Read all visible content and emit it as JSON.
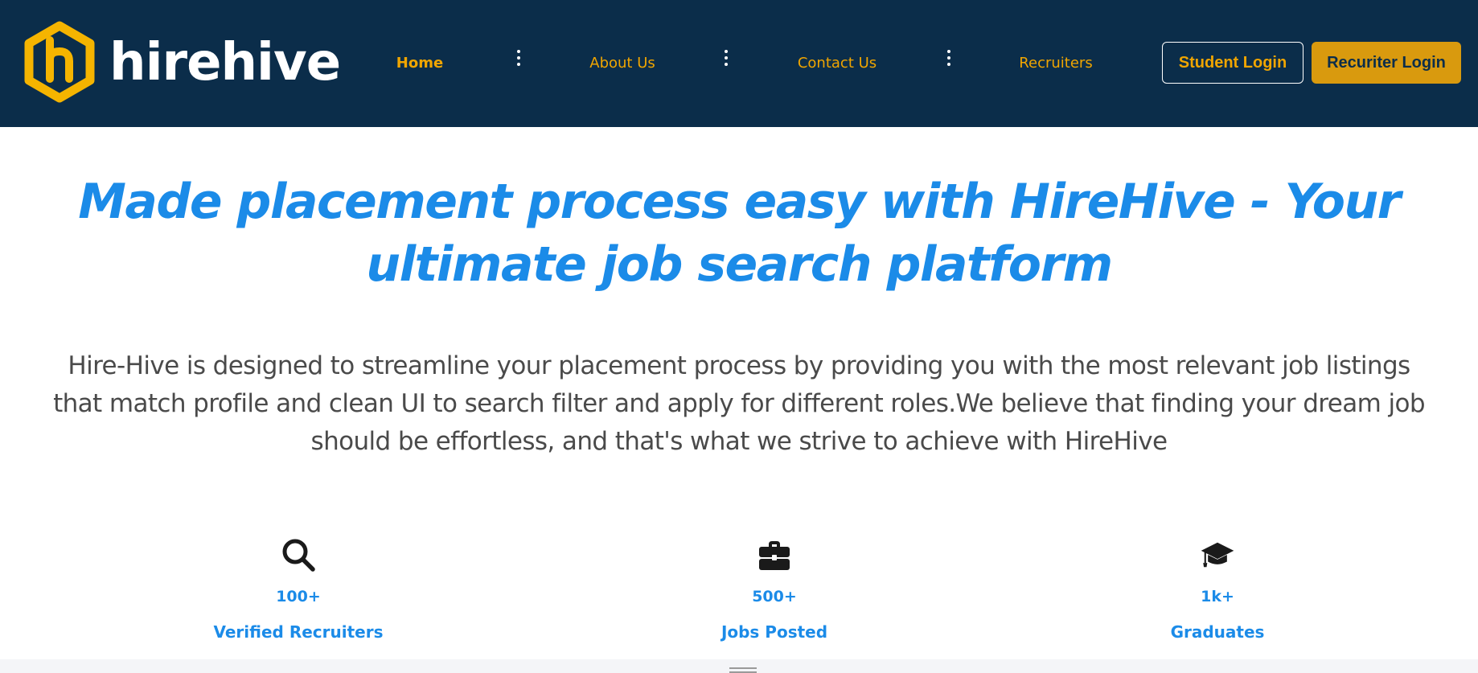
{
  "brand": {
    "name": "hirehive",
    "logo_icon": "hexagon-h-logo-icon",
    "logo_color": "#f5b400"
  },
  "nav": {
    "links": [
      {
        "label": "Home",
        "active": true
      },
      {
        "label": "About Us",
        "active": false
      },
      {
        "label": "Contact Us",
        "active": false
      },
      {
        "label": "Recruiters",
        "active": false
      }
    ],
    "separator_icon": "vertical-dots-icon",
    "student_login_label": "Student Login",
    "recruiter_login_label": "Recuriter Login"
  },
  "hero": {
    "title": "Made placement process easy with HireHive - Your ultimate job search platform",
    "description": "Hire-Hive is designed to streamline your placement process by providing you with the most relevant job listings that match profile and clean UI to search filter and apply for different roles.We believe that finding your dream job should be effortless, and that's what we strive to achieve with HireHive"
  },
  "stats": [
    {
      "icon": "search-icon",
      "value": "100+",
      "label": "Verified Recruiters"
    },
    {
      "icon": "briefcase-icon",
      "value": "500+",
      "label": "Jobs Posted"
    },
    {
      "icon": "graduation-cap-icon",
      "value": "1k+",
      "label": "Graduates"
    }
  ],
  "colors": {
    "navbar_bg": "#0b2d4a",
    "accent_gold": "#f0a500",
    "button_gold": "#d99a0e",
    "heading_blue": "#1b8be8",
    "body_text": "#4a4a4a"
  }
}
